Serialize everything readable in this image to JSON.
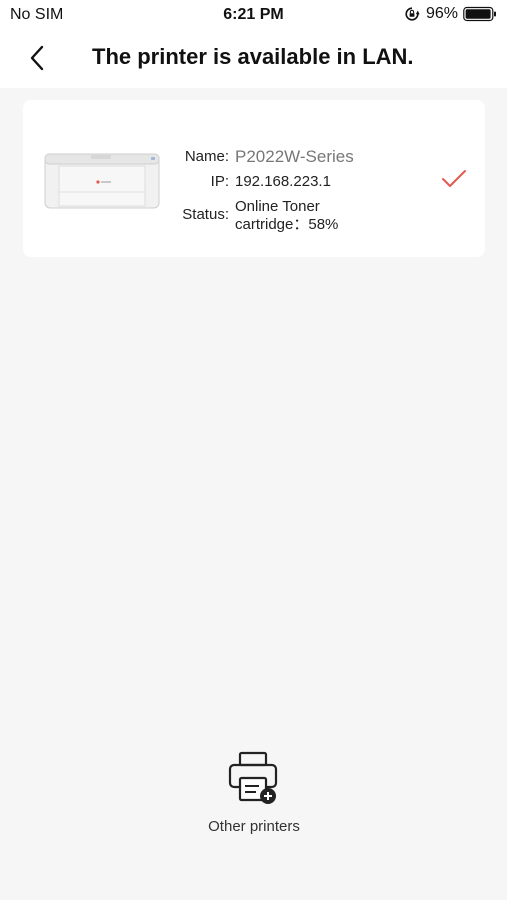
{
  "status_bar": {
    "carrier": "No SIM",
    "time": "6:21 PM",
    "battery_percent": "96%"
  },
  "nav": {
    "title": "The printer is available in LAN."
  },
  "printer": {
    "name_label": "Name:",
    "name_value": "P2022W-Series",
    "ip_label": "IP:",
    "ip_value": "192.168.223.1",
    "status_label": "Status:",
    "status_value": "Online   Toner cartridge：58%",
    "selected": true
  },
  "footer": {
    "other_printers_label": "Other printers"
  },
  "colors": {
    "accent_check": "#e05a4e",
    "background": "#f6f6f6",
    "card": "#ffffff"
  }
}
